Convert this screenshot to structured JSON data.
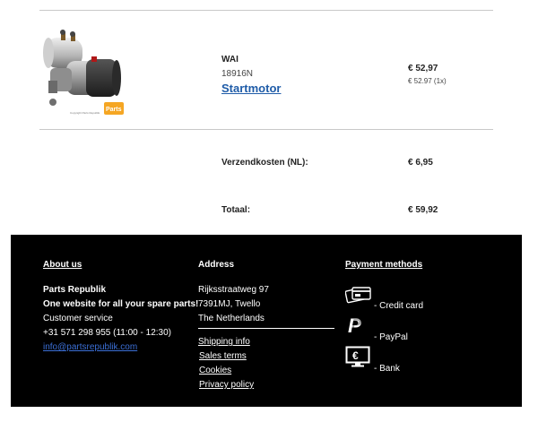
{
  "product": {
    "brand": "WAI",
    "sku": "18916N",
    "name": "Startmotor",
    "price": "€ 52,97",
    "price_detail": "€ 52.97 (1x)",
    "image_badge": "Parts",
    "image_caption": "Copyright Parts Republik"
  },
  "summary": {
    "shipping_label": "Verzendkosten (NL):",
    "shipping_value": "€ 6,95",
    "total_label": "Totaal:",
    "total_value": "€ 59,92"
  },
  "footer": {
    "about": {
      "heading": "About us",
      "company": "Parts Republik",
      "tagline": "One website for all your spare parts!",
      "service": "Customer service",
      "phone": "+31 571 298 955 (11:00 - 12:30)",
      "email": "info@partsrepublik.com"
    },
    "address": {
      "heading": "Address",
      "street": "Rijksstraatweg 97",
      "city": "7391MJ, Twello",
      "country": "The Netherlands",
      "links": [
        "Shipping info",
        "Sales terms",
        "Cookies",
        "Privacy policy"
      ]
    },
    "payment": {
      "heading": "Payment methods",
      "methods": [
        {
          "label": "- Credit card",
          "icon": "credit-card-icon"
        },
        {
          "label": "- PayPal",
          "icon": "paypal-icon"
        },
        {
          "label": "- Bank",
          "icon": "bank-euro-icon"
        }
      ]
    }
  },
  "colors": {
    "link": "#1f5ca8",
    "footer_bg": "#000000",
    "footer_link": "#3b6fd6"
  }
}
